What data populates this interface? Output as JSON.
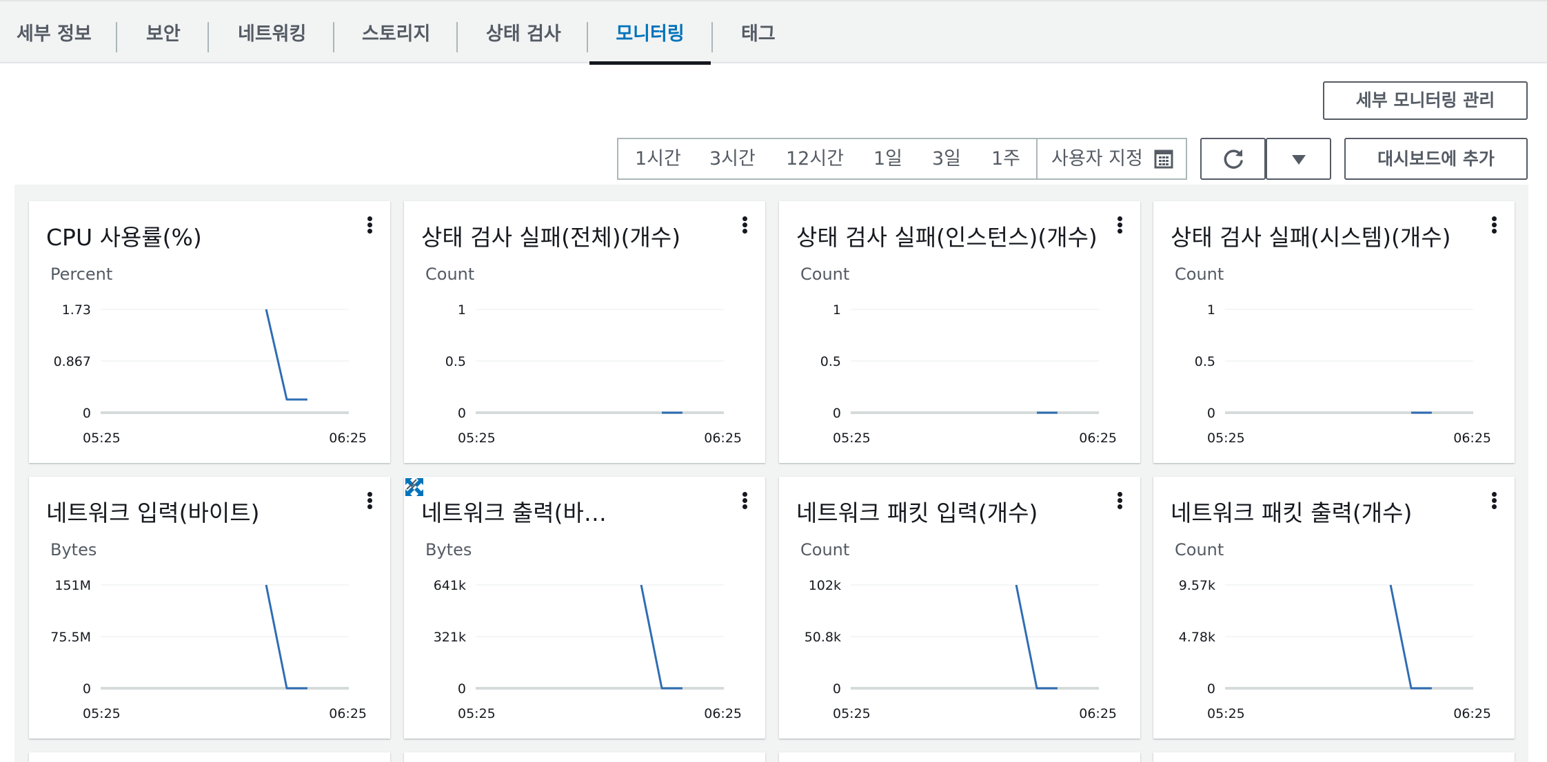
{
  "tabs": [
    {
      "label": "세부 정보",
      "active": false
    },
    {
      "label": "보안",
      "active": false
    },
    {
      "label": "네트워킹",
      "active": false
    },
    {
      "label": "스토리지",
      "active": false
    },
    {
      "label": "상태 검사",
      "active": false
    },
    {
      "label": "모니터링",
      "active": true
    },
    {
      "label": "태그",
      "active": false
    }
  ],
  "toolbar": {
    "manage_detailed_monitoring": "세부 모니터링 관리",
    "ranges": [
      "1시간",
      "3시간",
      "12시간",
      "1일",
      "3일",
      "1주"
    ],
    "custom_range": "사용자 지정",
    "refresh_icon": "refresh-icon",
    "dropdown_icon": "caret-down-icon",
    "add_to_dashboard": "대시보드에 추가"
  },
  "colors": {
    "accent": "#0073bb",
    "series": "#2f6db3",
    "baseline": "#d5dbdb"
  },
  "x_axis": {
    "start": "05:25",
    "end": "06:25"
  },
  "cards": [
    {
      "title": "CPU 사용률(%)",
      "unit": "Percent",
      "ticks": [
        "1.73",
        "0.867",
        "0"
      ],
      "ymax": 1.73,
      "series": [
        [
          0.667,
          1.73
        ],
        [
          0.75,
          0.22
        ],
        [
          0.833,
          0.22
        ]
      ]
    },
    {
      "title": "상태 검사 실패(전체)(개수)",
      "unit": "Count",
      "ticks": [
        "1",
        "0.5",
        "0"
      ],
      "ymax": 1,
      "series": [
        [
          0.75,
          0
        ],
        [
          0.833,
          0
        ]
      ]
    },
    {
      "title": "상태 검사 실패(인스턴스)(개수)",
      "unit": "Count",
      "ticks": [
        "1",
        "0.5",
        "0"
      ],
      "ymax": 1,
      "series": [
        [
          0.75,
          0
        ],
        [
          0.833,
          0
        ]
      ]
    },
    {
      "title": "상태 검사 실패(시스템)(개수)",
      "unit": "Count",
      "ticks": [
        "1",
        "0.5",
        "0"
      ],
      "ymax": 1,
      "series": [
        [
          0.75,
          0
        ],
        [
          0.833,
          0
        ]
      ]
    },
    {
      "title": "네트워크 입력(바이트)",
      "unit": "Bytes",
      "ticks": [
        "151M",
        "75.5M",
        "0"
      ],
      "ymax": 151,
      "series": [
        [
          0.667,
          151
        ],
        [
          0.75,
          0
        ],
        [
          0.833,
          0
        ]
      ]
    },
    {
      "title": "네트워크 출력(바…",
      "unit": "Bytes",
      "ticks": [
        "641k",
        "321k",
        "0"
      ],
      "ymax": 641,
      "series": [
        [
          0.667,
          641
        ],
        [
          0.75,
          0
        ],
        [
          0.833,
          0
        ]
      ],
      "hovered": true
    },
    {
      "title": "네트워크 패킷 입력(개수)",
      "unit": "Count",
      "ticks": [
        "102k",
        "50.8k",
        "0"
      ],
      "ymax": 102,
      "series": [
        [
          0.667,
          102
        ],
        [
          0.75,
          0
        ],
        [
          0.833,
          0
        ]
      ]
    },
    {
      "title": "네트워크 패킷 출력(개수)",
      "unit": "Count",
      "ticks": [
        "9.57k",
        "4.78k",
        "0"
      ],
      "ymax": 9.57,
      "series": [
        [
          0.667,
          9.57
        ],
        [
          0.75,
          0
        ],
        [
          0.833,
          0
        ]
      ]
    }
  ]
}
